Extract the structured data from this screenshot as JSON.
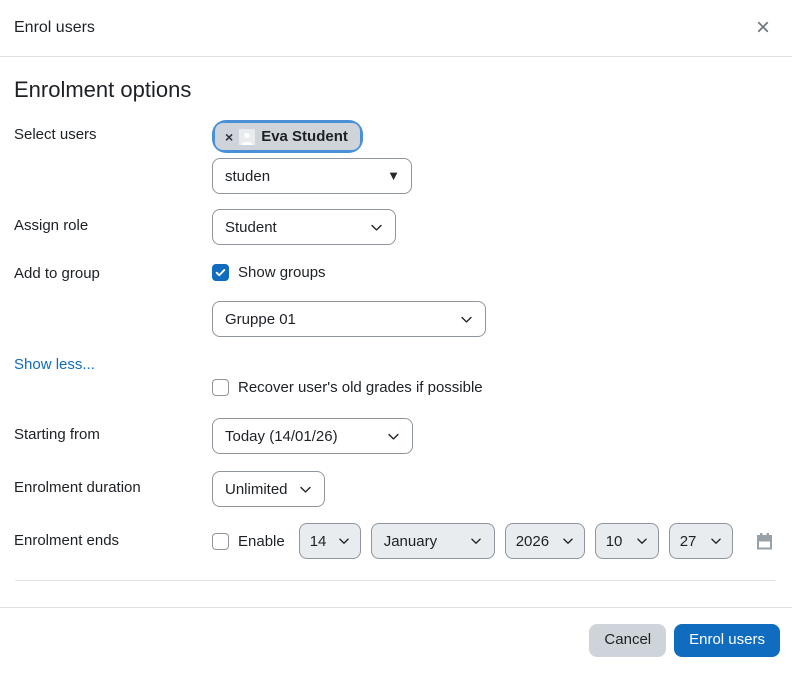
{
  "modal": {
    "title": "Enrol users",
    "close_icon": "×"
  },
  "form": {
    "heading": "Enrolment options",
    "select_users": {
      "label": "Select users",
      "selected_tag": {
        "remove_icon": "×",
        "name": "Eva Student"
      },
      "search_value": "studen",
      "dropdown_arrow": "▼"
    },
    "assign_role": {
      "label": "Assign role",
      "value": "Student"
    },
    "add_to_group": {
      "label": "Add to group",
      "checkbox_label": "Show groups",
      "checked": true,
      "group_value": "Gruppe 01"
    },
    "show_less_link": "Show less...",
    "recover_grades": {
      "label": "Recover user's old grades if possible",
      "checked": false
    },
    "starting_from": {
      "label": "Starting from",
      "value": "Today (14/01/26)"
    },
    "enrolment_duration": {
      "label": "Enrolment duration",
      "value": "Unlimited"
    },
    "enrolment_ends": {
      "label": "Enrolment ends",
      "enable_label": "Enable",
      "enabled": false,
      "day": "14",
      "month": "January",
      "year": "2026",
      "hour": "10",
      "minute": "27"
    }
  },
  "footer": {
    "cancel_label": "Cancel",
    "submit_label": "Enrol users"
  },
  "colors": {
    "primary": "#0f6cbf",
    "link": "#0f6cbf",
    "divider": "#dee2e6",
    "input_border": "#8f959e",
    "disabled_bg": "#e9ecef",
    "tag_bg": "#ced4da",
    "focus_ring": "#4a90d9",
    "text": "#1d2125"
  }
}
